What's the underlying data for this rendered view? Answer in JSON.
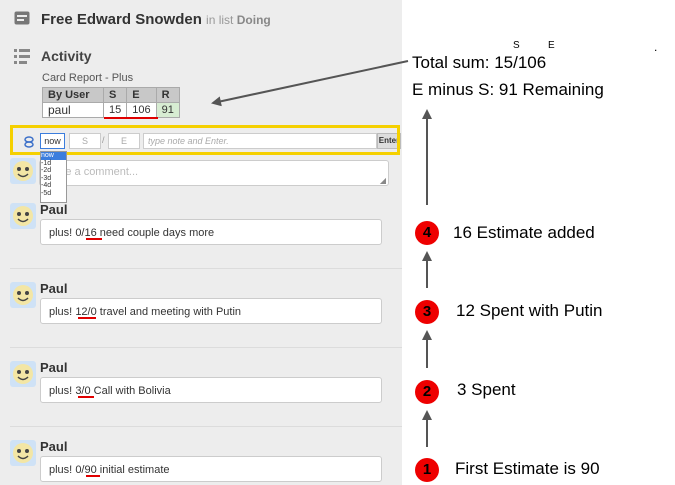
{
  "card": {
    "title": "Free Edward Snowden",
    "in_list_prefix": "in list",
    "list_name": "Doing"
  },
  "activity": {
    "title": "Activity",
    "report_title": "Card Report - Plus"
  },
  "report": {
    "headers": [
      "By User",
      "S",
      "E",
      "R"
    ],
    "row": {
      "user": "paul",
      "s": "15",
      "e": "106",
      "r": "91"
    }
  },
  "entry": {
    "now_label": "now",
    "s_placeholder": "S",
    "e_placeholder": "E",
    "note_placeholder": "type note and Enter.",
    "enter_label": "Enter",
    "dropdown_options": [
      "now",
      "-1d",
      "-2d",
      "-3d",
      "-4d",
      "-5d"
    ]
  },
  "comment_placeholder": "Write a comment...",
  "entries": [
    {
      "author": "Paul",
      "prefix": "plus!",
      "value": "0/16",
      "text": "need couple days more"
    },
    {
      "author": "Paul",
      "prefix": "plus!",
      "value": "12/0",
      "text": "travel and meeting with Putin"
    },
    {
      "author": "Paul",
      "prefix": "plus!",
      "value": "3/0",
      "text": "Call with Bolivia"
    },
    {
      "author": "Paul",
      "prefix": "plus!",
      "value": "0/90",
      "text": "initial estimate"
    }
  ],
  "annotations": {
    "total_line": "Total sum: 15/106",
    "s_marker": "S",
    "e_marker": "E",
    "dot": ".",
    "remaining_line": "E minus S: 91  Remaining",
    "steps": [
      {
        "num": "4",
        "text": "16  Estimate added"
      },
      {
        "num": "3",
        "text": "12 Spent with Putin"
      },
      {
        "num": "2",
        "text": "3 Spent"
      },
      {
        "num": "1",
        "text": "First  Estimate is 90"
      }
    ]
  },
  "colors": {
    "highlight": "#f5d000",
    "underline": "#e00000",
    "step_circle": "#ee0000",
    "remaining_cell": "#d7ecd2"
  }
}
